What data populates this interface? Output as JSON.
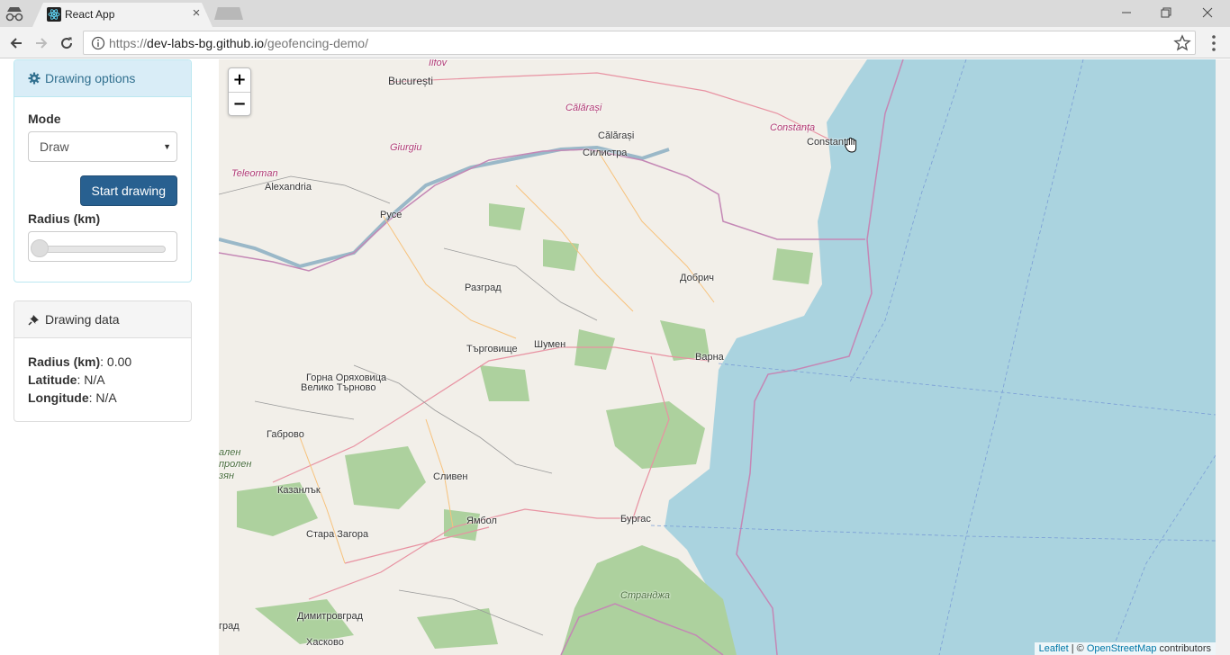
{
  "browser": {
    "tab_title": "React App",
    "tab_close": "×",
    "url_scheme": "https://",
    "url_host": "dev-labs-bg.github.io",
    "url_path": "/geofencing-demo/",
    "icons": [
      "incognito-icon",
      "react-favicon-icon",
      "back-icon",
      "forward-icon",
      "reload-icon",
      "info-icon",
      "star-icon",
      "menu-icon"
    ]
  },
  "drawing_options": {
    "title": "Drawing options",
    "mode_label": "Mode",
    "mode_value": "Draw",
    "start_button": "Start drawing",
    "radius_label": "Radius (km)",
    "radius_slider_fraction": 0
  },
  "drawing_data": {
    "title": "Drawing data",
    "radius_label": "Radius (km)",
    "radius_value": ": 0.00",
    "latitude_label": "Latitude",
    "latitude_value": ": N/A",
    "longitude_label": "Longitude",
    "longitude_value": ": N/A"
  },
  "map": {
    "zoom_in": "+",
    "zoom_out": "−",
    "attribution_leaflet": "Leaflet",
    "attribution_sep": " | © ",
    "attribution_osm": "OpenStreetMap",
    "attribution_tail": " contributors",
    "colors": {
      "sea": "#aad3df",
      "land": "#f2efe9",
      "forest": "#add19e",
      "border": "#c487b5",
      "road": "#e892a2"
    },
    "places": {
      "ilfov": "Ilfov",
      "bucuresti": "București",
      "calarasi_region": "Călărași",
      "calarasi": "Călărași",
      "silistra": "Силистра",
      "giurgiu": "Giurgiu",
      "constanta_region": "Constanța",
      "constanta": "Constanța",
      "teleorman": "Teleorman",
      "alexandria": "Alexandria",
      "ruse": "Русе",
      "razgrad": "Разград",
      "dobrich": "Добрич",
      "targovishte": "Търговище",
      "shumen": "Шумен",
      "varna": "Варна",
      "gorna": "Горна Оряховица",
      "veliko": "Велико Търново",
      "gabrovo": "Габрово",
      "kazanlak": "Казанлък",
      "sliven": "Сливен",
      "burgas": "Бургас",
      "yambol": "Ямбол",
      "stara": "Стара Загора",
      "strandzha": "Странджа",
      "dimitrovgrad": "Димитровград",
      "haskovo": "Хасково",
      "edge1": "ален",
      "edge2": "пролен",
      "edge3": "зян",
      "edge4": "град"
    }
  }
}
